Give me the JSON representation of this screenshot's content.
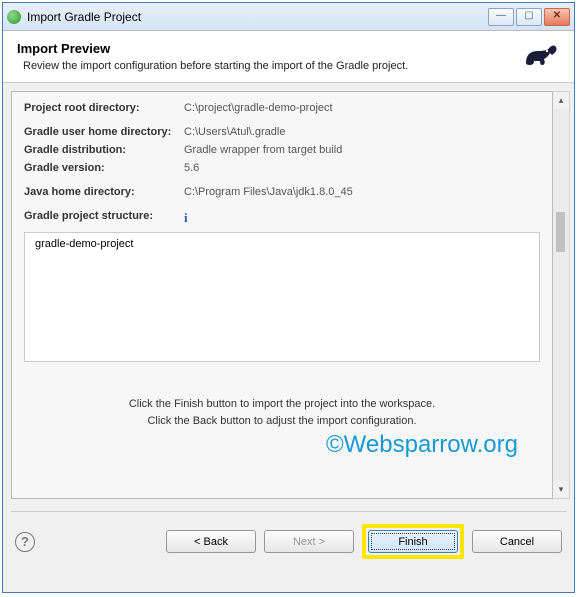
{
  "titlebar": {
    "text": "Import Gradle Project"
  },
  "header": {
    "title": "Import Preview",
    "subtitle": "Review the import configuration before starting the import of the Gradle project."
  },
  "props": {
    "root_label": "Project root directory:",
    "root_value": "C:\\project\\gradle-demo-project",
    "userhome_label": "Gradle user home directory:",
    "userhome_value": "C:\\Users\\Atul\\.gradle",
    "dist_label": "Gradle distribution:",
    "dist_value": "Gradle wrapper from target build",
    "version_label": "Gradle version:",
    "version_value": "5.6",
    "javahome_label": "Java home directory:",
    "javahome_value": "C:\\Program Files\\Java\\jdk1.8.0_45",
    "structure_label": "Gradle project structure:"
  },
  "tree": {
    "root": "gradle-demo-project"
  },
  "hints": {
    "line1": "Click the Finish button to import the project into the workspace.",
    "line2": "Click the Back button to adjust the import configuration."
  },
  "watermark": "©Websparrow.org",
  "buttons": {
    "back": "< Back",
    "next": "Next >",
    "finish": "Finish",
    "cancel": "Cancel"
  }
}
